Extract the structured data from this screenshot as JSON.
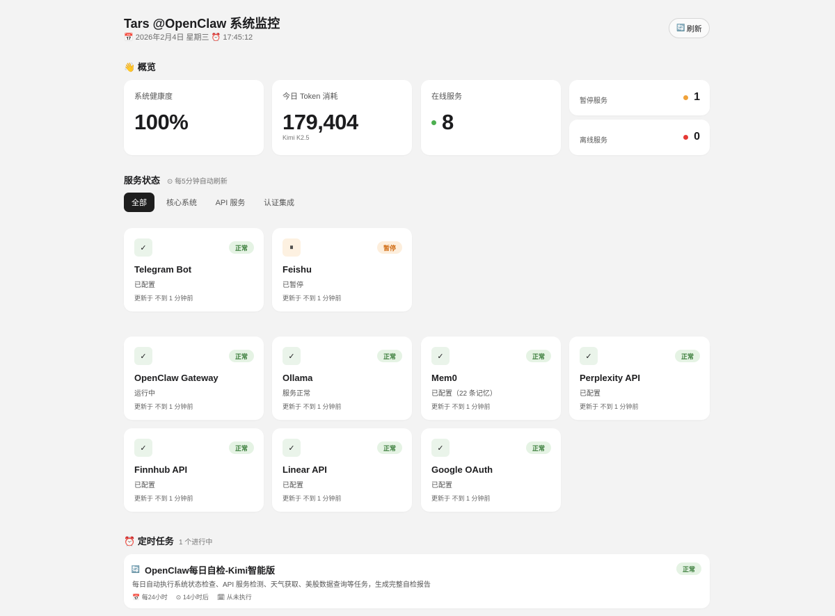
{
  "header": {
    "title": "Tars @OpenClaw 系统监控",
    "date_icon": "📅",
    "date": "2026年2月4日 星期三",
    "time_icon": "⏰",
    "time": "17:45:12",
    "refresh_icon": "🔄",
    "refresh_label": "刷新"
  },
  "overview": {
    "section_icon": "👋",
    "section_title": "概览",
    "health": {
      "label": "系统健康度",
      "value": "100%"
    },
    "tokens": {
      "label": "今日 Token 消耗",
      "value": "179,404",
      "model": "Kimi K2.5"
    },
    "online": {
      "label": "在线服务",
      "value": "8",
      "dot_color": "#4caf50"
    },
    "paused": {
      "label": "暂停服务",
      "value": "1",
      "dot_color": "#f0a23a"
    },
    "offline": {
      "label": "离线服务",
      "value": "0",
      "dot_color": "#e53935"
    }
  },
  "services": {
    "section_title": "服务状态",
    "note_icon": "⊙",
    "note": "每5分钟自动刷新",
    "tabs": [
      "全部",
      "核心系统",
      "API 服务",
      "认证集成"
    ],
    "active_tab": "全部",
    "items": [
      {
        "name": "Telegram Bot",
        "status": "正常",
        "icon": "✓",
        "desc": "已配置",
        "updated": "更新于 不到 1 分钟前"
      },
      {
        "name": "Feishu",
        "status": "暂停",
        "icon": "⏸",
        "desc": "已暂停",
        "updated": "更新于 不到 1 分钟前"
      },
      {
        "name": "OpenClaw Gateway",
        "status": "正常",
        "icon": "✓",
        "desc": "运行中",
        "updated": "更新于 不到 1 分钟前"
      },
      {
        "name": "Ollama",
        "status": "正常",
        "icon": "✓",
        "desc": "服务正常",
        "updated": "更新于 不到 1 分钟前"
      },
      {
        "name": "Mem0",
        "status": "正常",
        "icon": "✓",
        "desc": "已配置（22 条记忆）",
        "updated": "更新于 不到 1 分钟前"
      },
      {
        "name": "Perplexity API",
        "status": "正常",
        "icon": "✓",
        "desc": "已配置",
        "updated": "更新于 不到 1 分钟前"
      },
      {
        "name": "Finnhub API",
        "status": "正常",
        "icon": "✓",
        "desc": "已配置",
        "updated": "更新于 不到 1 分钟前"
      },
      {
        "name": "Linear API",
        "status": "正常",
        "icon": "✓",
        "desc": "已配置",
        "updated": "更新于 不到 1 分钟前"
      },
      {
        "name": "Google OAuth",
        "status": "正常",
        "icon": "✓",
        "desc": "已配置",
        "updated": "更新于 不到 1 分钟前"
      }
    ]
  },
  "tasks": {
    "section_icon": "⏰",
    "section_title": "定时任务",
    "count_text": "1 个进行中",
    "items": [
      {
        "icon": "🔄",
        "title": "OpenClaw每日自检-Kimi智能版",
        "status": "正常",
        "desc": "每日自动执行系统状态检查、API 服务检测、天气获取、美股数据查询等任务，生成完整自检报告",
        "interval_icon": "📅",
        "interval": "每24小时",
        "next_icon": "⊙",
        "next": "14小时后",
        "last_icon": "🗓",
        "last": "从未执行"
      }
    ]
  }
}
